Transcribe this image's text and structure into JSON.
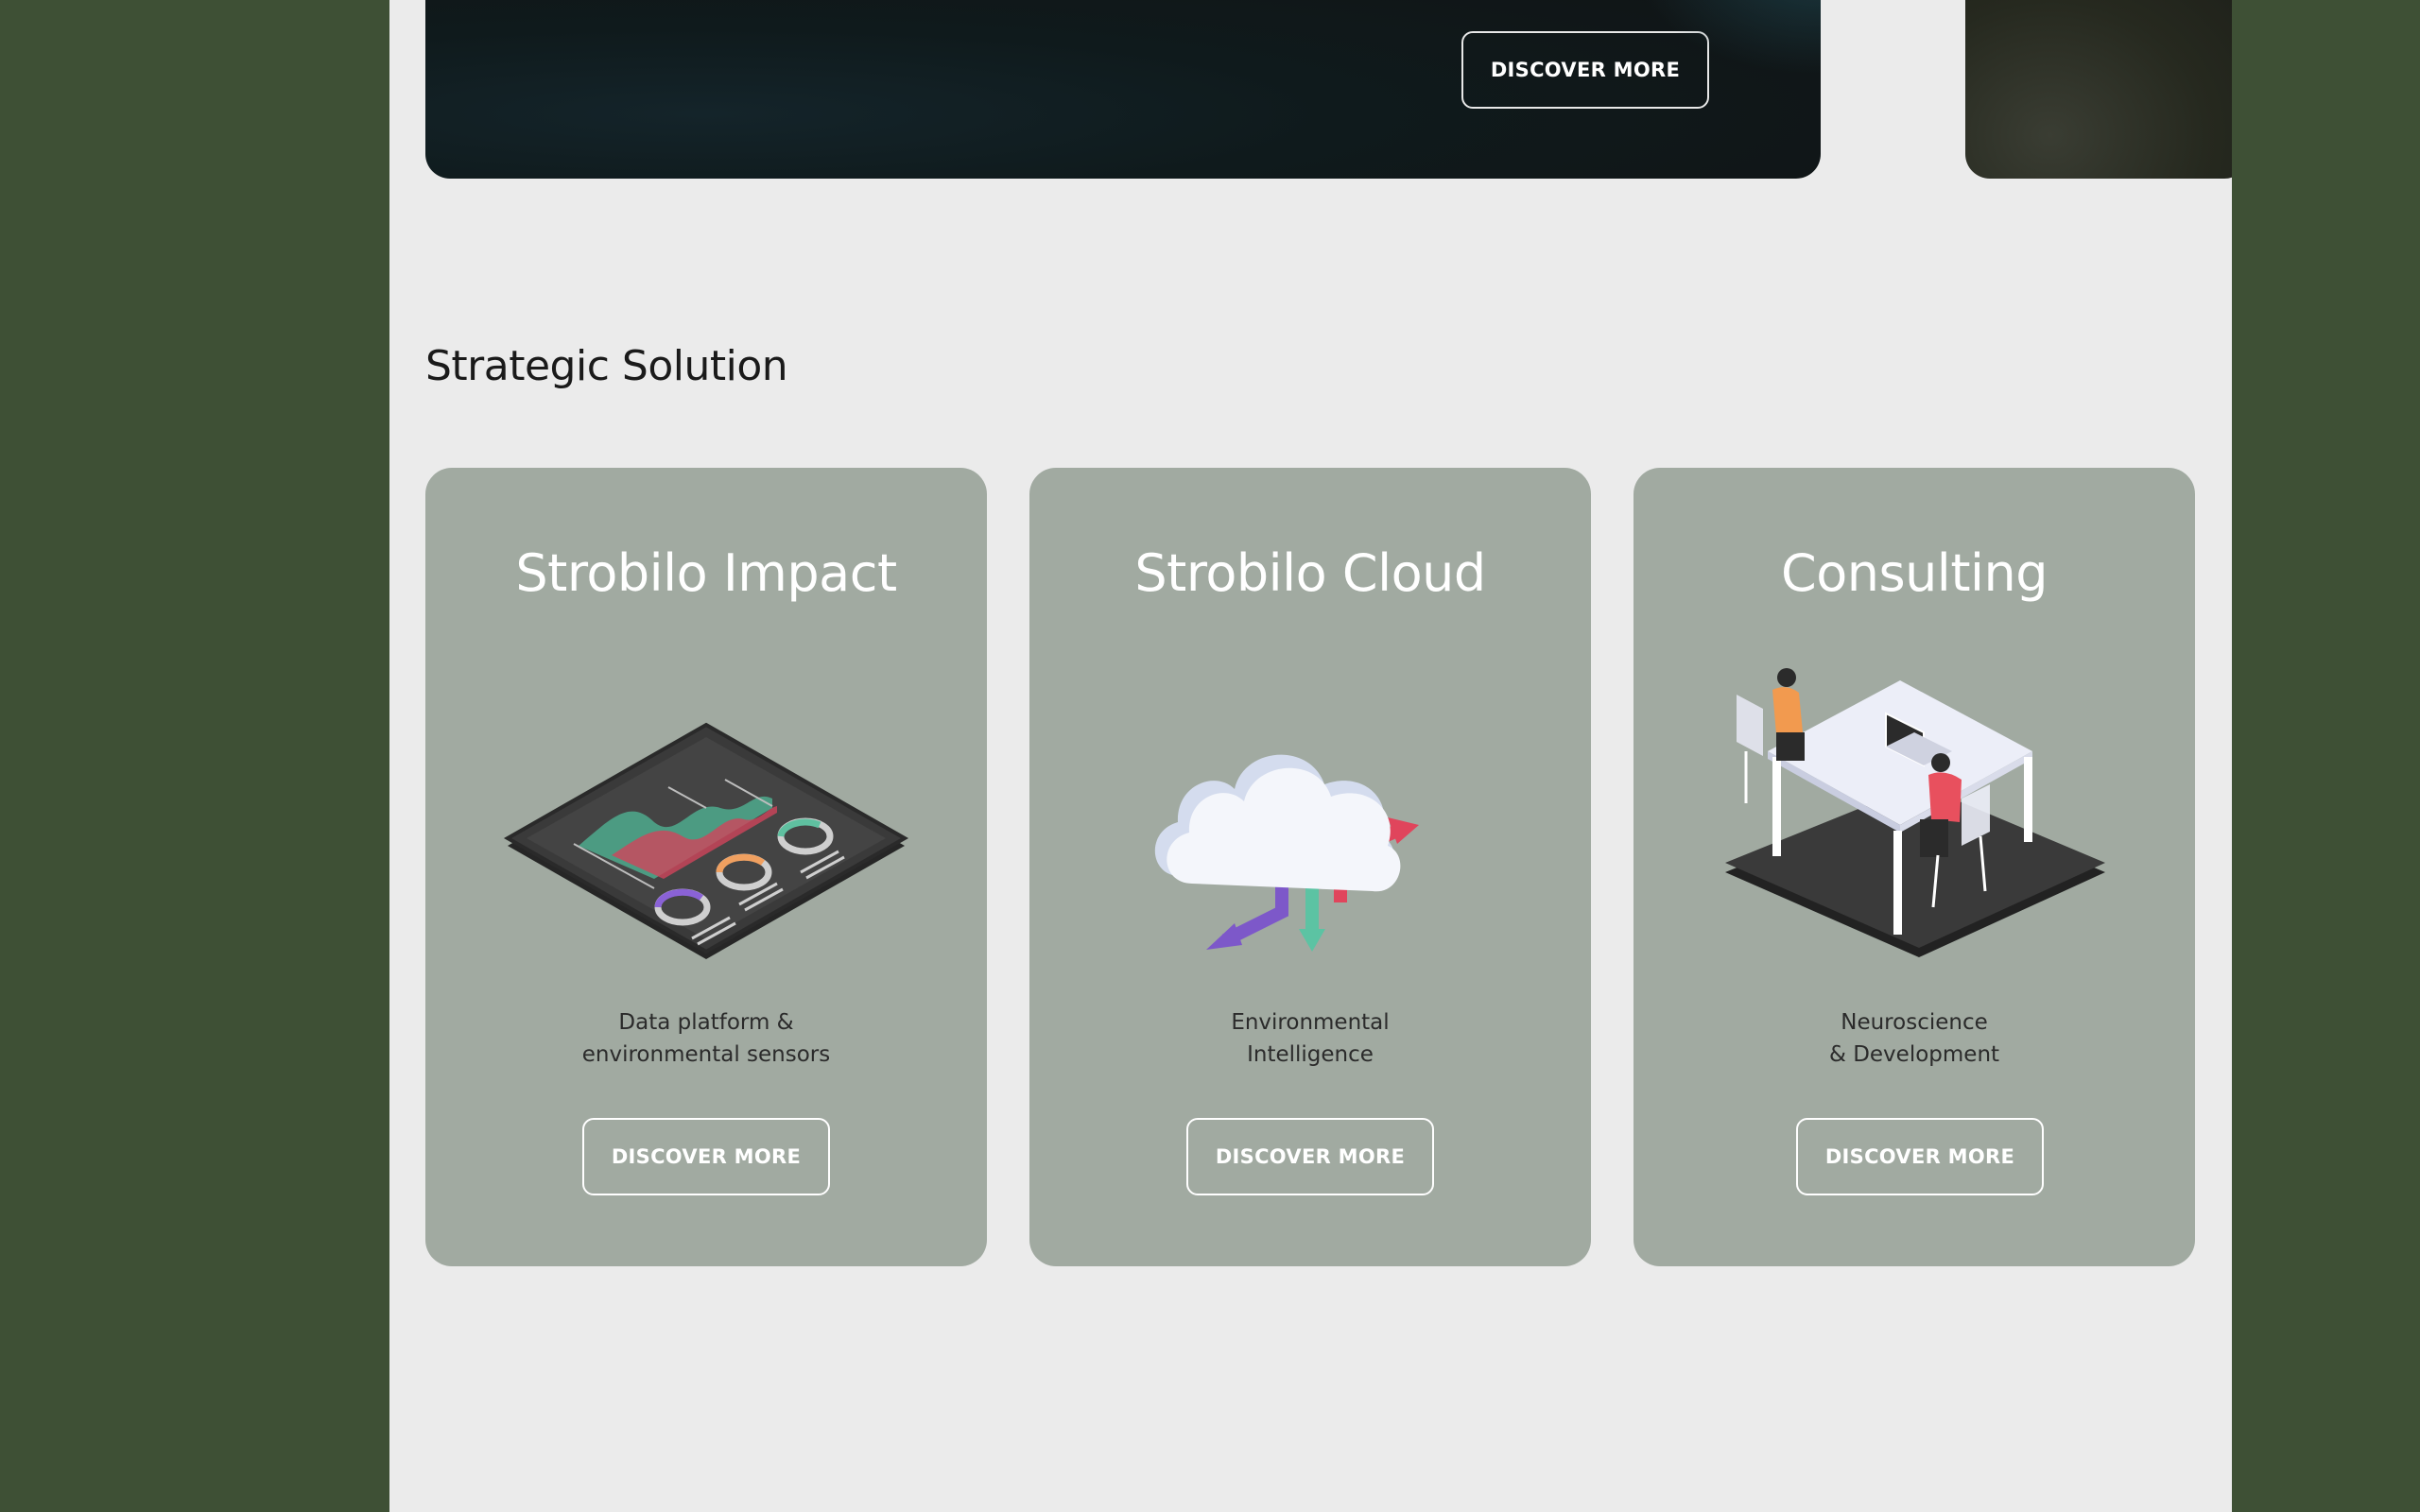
{
  "hero": {
    "button_label": "DISCOVER MORE"
  },
  "section": {
    "title": "Strategic Solution"
  },
  "cards": [
    {
      "title": "Strobilo Impact",
      "description": "Data platform &\nenvironmental sensors",
      "button_label": "DISCOVER MORE",
      "illustration": "dashboard-tablet-icon"
    },
    {
      "title": "Strobilo Cloud",
      "description": "Environmental\nIntelligence",
      "button_label": "DISCOVER MORE",
      "illustration": "cloud-arrows-icon"
    },
    {
      "title": "Consulting",
      "description": "Neuroscience\n& Development",
      "button_label": "DISCOVER MORE",
      "illustration": "meeting-desk-icon"
    }
  ],
  "colors": {
    "background": "#3e5035",
    "page": "#ebebeb",
    "card": "#a1aaa1",
    "hero": "#111314"
  }
}
